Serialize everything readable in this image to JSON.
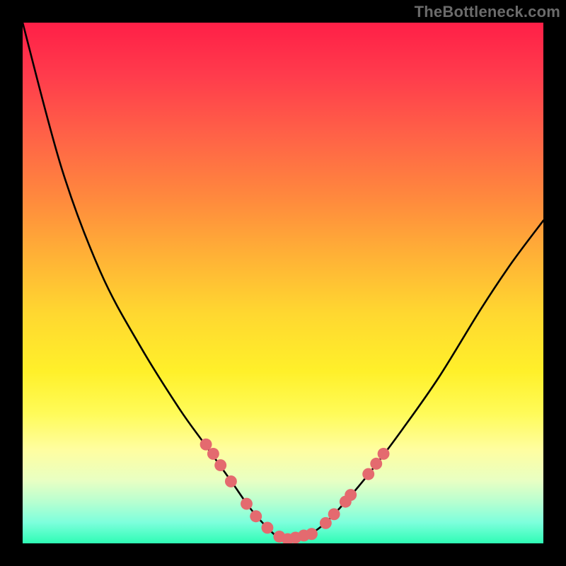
{
  "watermark": "TheBottleneck.com",
  "chart_data": {
    "type": "line",
    "title": "",
    "xlabel": "",
    "ylabel": "",
    "xlim": [
      0,
      100
    ],
    "ylim": [
      0,
      100
    ],
    "grid": false,
    "legend": false,
    "series": [
      {
        "name": "curve",
        "color": "#000000",
        "x": [
          0,
          7.5,
          15,
          22.5,
          30,
          35,
          40,
          43.5,
          46.5,
          49,
          51,
          53,
          55,
          58,
          62,
          67,
          73,
          80,
          88,
          94,
          100
        ],
        "y": [
          100,
          72,
          52,
          38,
          26,
          19,
          12,
          7,
          3.5,
          1.2,
          0.5,
          0.7,
          1.6,
          3.8,
          8,
          14,
          22,
          32,
          45,
          54,
          62
        ]
      }
    ],
    "points": {
      "name": "markers",
      "color": "#e46a6f",
      "radius_pct": 1.15,
      "xy": [
        [
          35.2,
          19.0
        ],
        [
          36.6,
          17.2
        ],
        [
          38.0,
          15.0
        ],
        [
          40.0,
          11.9
        ],
        [
          43.0,
          7.6
        ],
        [
          44.8,
          5.2
        ],
        [
          47.0,
          3.0
        ],
        [
          49.3,
          1.3
        ],
        [
          50.9,
          0.8
        ],
        [
          52.4,
          1.1
        ],
        [
          54.0,
          1.5
        ],
        [
          55.5,
          1.8
        ],
        [
          58.2,
          3.9
        ],
        [
          59.8,
          5.6
        ],
        [
          62.0,
          8.0
        ],
        [
          63.0,
          9.3
        ],
        [
          66.4,
          13.3
        ],
        [
          67.9,
          15.3
        ],
        [
          69.3,
          17.2
        ]
      ]
    }
  }
}
